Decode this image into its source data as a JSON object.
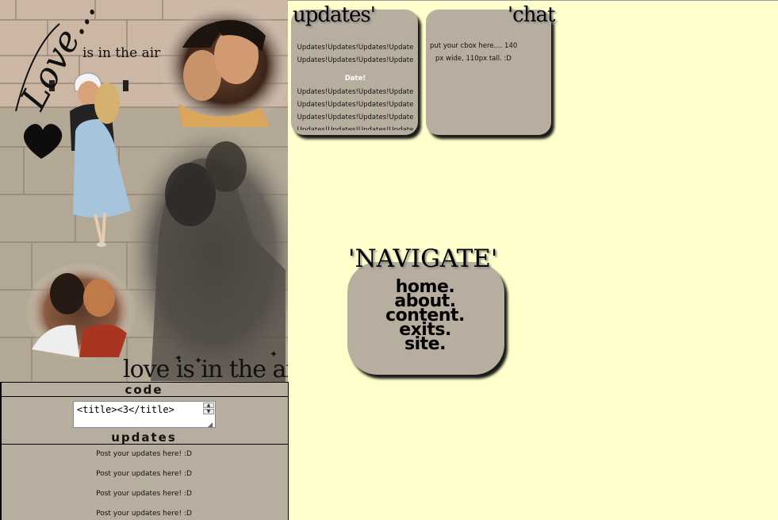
{
  "collage": {
    "script_text": "Love...",
    "tagline_top": "is in the air",
    "tagline_bottom": "love is in the air"
  },
  "code_box": {
    "heading": "code",
    "value": "<title><3</title>"
  },
  "updates_box": {
    "heading": "updates",
    "lines": [
      "Post your updates here! :D",
      "Post your updates here! :D",
      "Post your updates here! :D",
      "Post your updates here! :D"
    ]
  },
  "updates_panel": {
    "title": "updates'",
    "rows": [
      "Updates!Updates!Updates!Update",
      "Updates!Updates!Updates!Update",
      "Date!",
      "Updates!Updates!Updates!Update",
      "Updates!Updates!Updates!Update",
      "Updates!Updates!Updates!Update",
      "Updates!Updates!Updates!Update"
    ]
  },
  "chat_panel": {
    "title": "'chat",
    "text_line1": "put your cbox here.... 140",
    "text_line2": "px wide, 110px tall. :D"
  },
  "navigate": {
    "title": "'NAVIGATE'",
    "links": [
      "home.",
      "about.",
      "content.",
      "exits.",
      "site."
    ]
  },
  "colors": {
    "page_bg": "#ffffcc",
    "panel_bg": "#b8ae9f",
    "text": "#111111"
  }
}
